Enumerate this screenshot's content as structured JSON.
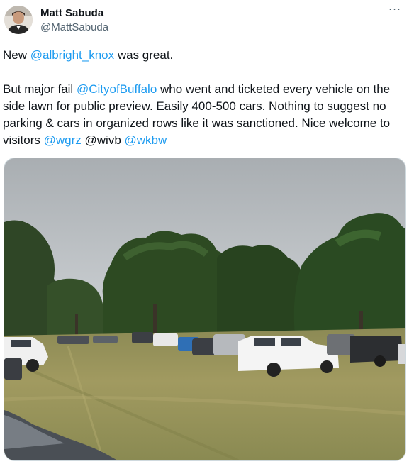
{
  "author": {
    "name": "Matt Sabuda",
    "handle": "@MattSabuda"
  },
  "more_icon": "more-horizontal-icon",
  "more_label": "···",
  "paragraph1": {
    "prefix": "New ",
    "mention": "@albright_knox",
    "suffix": " was great."
  },
  "paragraph2": {
    "text1": "But major fail ",
    "mention1": "@CityofBuffalo",
    "text2": " who went and ticketed every vehicle on the side lawn for public preview. Easily 400-500 cars. Nothing to suggest no parking & cars in organized rows like it was sanctioned. Nice welcome to visitors ",
    "mention2": "@wgrz",
    "text3": " @wivb ",
    "mention3": "@wkbw"
  },
  "colors": {
    "link": "#1d9bf0",
    "text": "#0f1419",
    "secondary": "#536471"
  }
}
